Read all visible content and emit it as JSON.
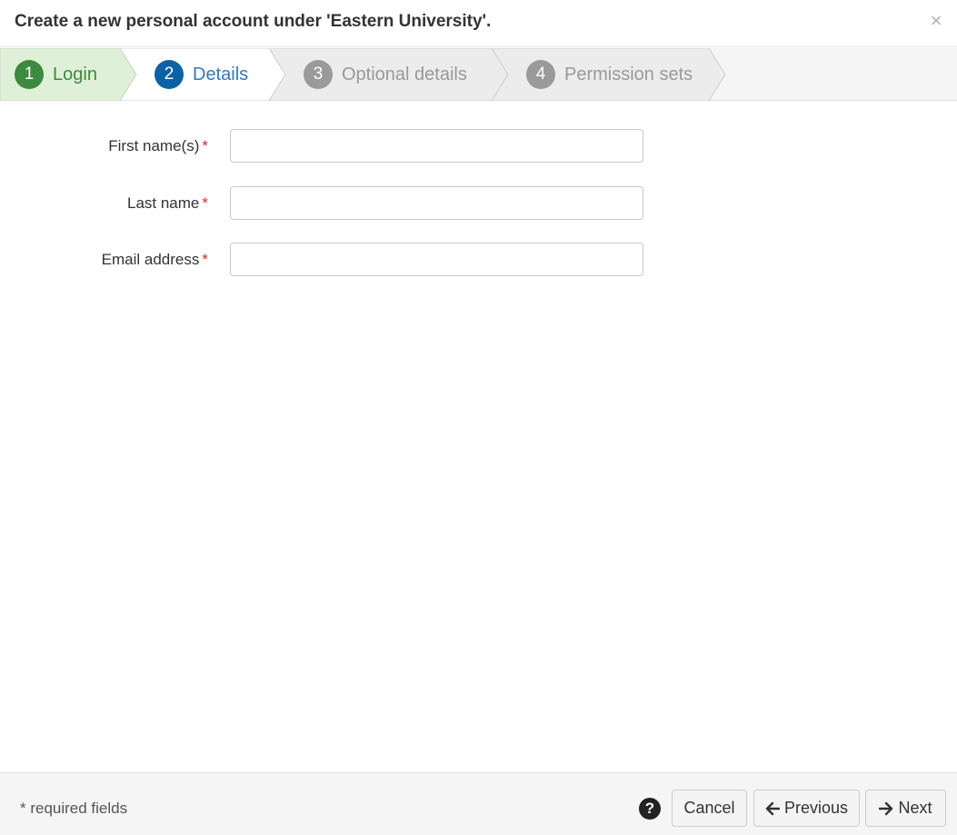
{
  "dialog": {
    "title": "Create a new personal account under 'Eastern University'.",
    "close_symbol": "×"
  },
  "steps": [
    {
      "number": "1",
      "label": "Login",
      "state": "completed",
      "color": "#3c8a3e"
    },
    {
      "number": "2",
      "label": "Details",
      "state": "active",
      "color": "#0b62a4"
    },
    {
      "number": "3",
      "label": "Optional details",
      "state": "pending",
      "color": "#9a9a9a"
    },
    {
      "number": "4",
      "label": "Permission sets",
      "state": "pending",
      "color": "#9a9a9a"
    }
  ],
  "form": {
    "required_marker": "*",
    "fields": [
      {
        "label": "First name(s)",
        "value": ""
      },
      {
        "label": "Last name",
        "value": ""
      },
      {
        "label": "Email address",
        "value": ""
      }
    ]
  },
  "footer": {
    "required_note": "* required fields",
    "help_symbol": "?",
    "cancel_label": "Cancel",
    "previous_label": "Previous",
    "next_label": "Next"
  },
  "icons": {
    "close": "close-icon",
    "help": "question-circle-icon",
    "previous": "arrow-left-icon",
    "next": "arrow-right-icon"
  }
}
